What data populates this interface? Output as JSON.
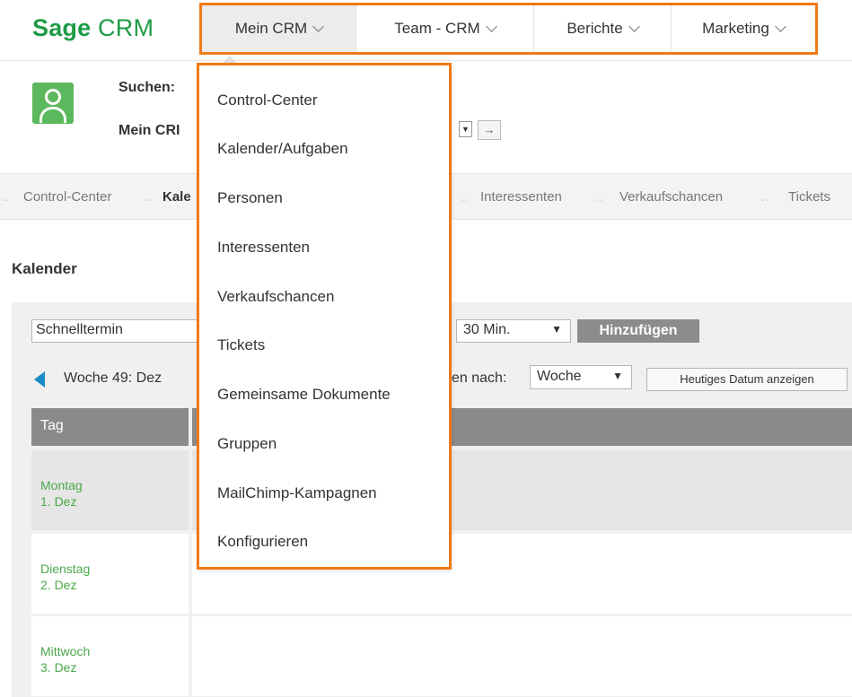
{
  "brand": {
    "name_part1": "Sage",
    "name_part2": "CRM"
  },
  "main_nav": [
    {
      "label": "Mein CRM",
      "active": true
    },
    {
      "label": "Team - CRM",
      "active": false
    },
    {
      "label": "Berichte",
      "active": false
    },
    {
      "label": "Marketing",
      "active": false
    }
  ],
  "header": {
    "search_label": "Suchen:",
    "mycrm_label": "Mein CRI",
    "go_symbol": "→",
    "select_arrow": "▼"
  },
  "sub_nav": {
    "items": [
      "Control-Center",
      "Kale",
      "Interessenten",
      "Verkaufschancen",
      "Tickets"
    ],
    "active": "Kale"
  },
  "page_title": "Kalender",
  "quick_entry": {
    "placeholder": "Schnelltermin",
    "duration": "30 Min.",
    "add_label": "Hinzufügen"
  },
  "week": {
    "label": "Woche 49: Dez",
    "view_label": "en nach:",
    "view_value": "Woche",
    "today_label": "Heutiges Datum anzeigen"
  },
  "table": {
    "header_day": "Tag",
    "rows": [
      {
        "weekday": "Montag",
        "date": "1. Dez"
      },
      {
        "weekday": "Dienstag",
        "date": "2. Dez"
      },
      {
        "weekday": "Mittwoch",
        "date": "3. Dez"
      }
    ]
  },
  "dropdown_items": [
    "Control-Center",
    "Kalender/Aufgaben",
    "Personen",
    "Interessenten",
    "Verkaufschancen",
    "Tickets",
    "Gemeinsame Dokumente",
    "Gruppen",
    "MailChimp-Kampagnen",
    "Konfigurieren"
  ],
  "colors": {
    "brand_green": "#1e9b46",
    "highlight_orange": "#f07a15",
    "date_green": "#4aa84a",
    "week_arrow_blue": "#1a8cc8"
  },
  "icons": {
    "avatar": "user-icon",
    "week_prev": "triangle-left-icon",
    "nav_chevron": "chevron-down-icon"
  }
}
